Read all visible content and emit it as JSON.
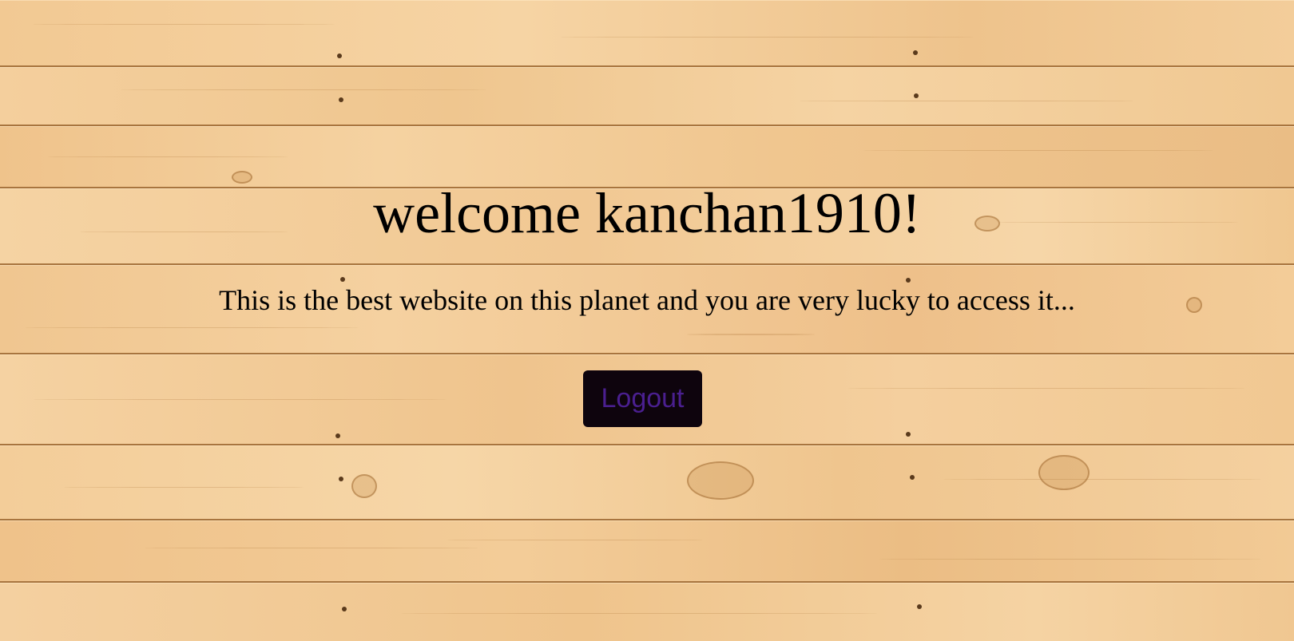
{
  "page": {
    "title": "welcome kanchan1910!",
    "message": "This is the best website on this planet and you are very lucky to access it...",
    "logout_label": "Logout"
  },
  "colors": {
    "background": "#efc48b",
    "text": "#000000",
    "button_background": "#0e040d",
    "button_text": "#4a1f8f"
  },
  "background_image": "wooden-planks-texture"
}
